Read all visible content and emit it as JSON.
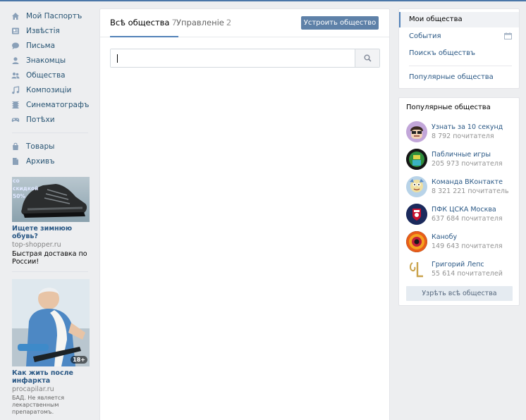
{
  "nav": {
    "items": [
      {
        "label": "Мой Паспортъ",
        "icon": "home-icon"
      },
      {
        "label": "Извѣстія",
        "icon": "news-icon"
      },
      {
        "label": "Письма",
        "icon": "messages-icon"
      },
      {
        "label": "Знакомцы",
        "icon": "friends-icon"
      },
      {
        "label": "Общества",
        "icon": "groups-icon"
      },
      {
        "label": "Композиціи",
        "icon": "music-icon"
      },
      {
        "label": "Синематографъ",
        "icon": "video-icon"
      },
      {
        "label": "Потѣхи",
        "icon": "games-icon"
      }
    ],
    "extra": [
      {
        "label": "Товары",
        "icon": "market-icon"
      },
      {
        "label": "Архивъ",
        "icon": "archive-icon"
      }
    ]
  },
  "ads": [
    {
      "title": "Ищете зимнюю обувь?",
      "domain": "top-shopper.ru",
      "text": "Быстрая доставка по России!",
      "img_label": "со скидкой 50%"
    },
    {
      "title": "Как жить после инфаркта",
      "domain": "procapilar.ru",
      "text": "БАД. Не является лекарственным препаратомъ.",
      "badge": "18+"
    }
  ],
  "tabs": [
    {
      "label": "Всѣ общества",
      "count": "7"
    },
    {
      "label": "Управленіе",
      "count": "2"
    }
  ],
  "create_button": "Устроить общество",
  "search": {
    "value": "",
    "placeholder": ""
  },
  "right_menu": {
    "items": [
      "Мои общества",
      "События",
      "Поискъ обществъ",
      "Популярные общества"
    ]
  },
  "popular": {
    "title": "Популярные общества",
    "groups": [
      {
        "name": "Узнать за 10 секунд",
        "subs": "8 792 почитателя"
      },
      {
        "name": "Пабличные игры",
        "subs": "205 973 почитателя"
      },
      {
        "name": "Команда ВКонтакте",
        "subs": "8 321 221 почитатель"
      },
      {
        "name": "ПФК ЦСКА Москва",
        "subs": "637 684 почитателя"
      },
      {
        "name": "Канобу",
        "subs": "149 643 почитателя"
      },
      {
        "name": "Григорий Лепс",
        "subs": "55 614 почитателей"
      }
    ],
    "all_button": "Узрѣть всѣ общества"
  },
  "colors": {
    "accent": "#5181b8",
    "link": "#2a5885",
    "button": "#5e81a8",
    "bg": "#edeef0"
  }
}
